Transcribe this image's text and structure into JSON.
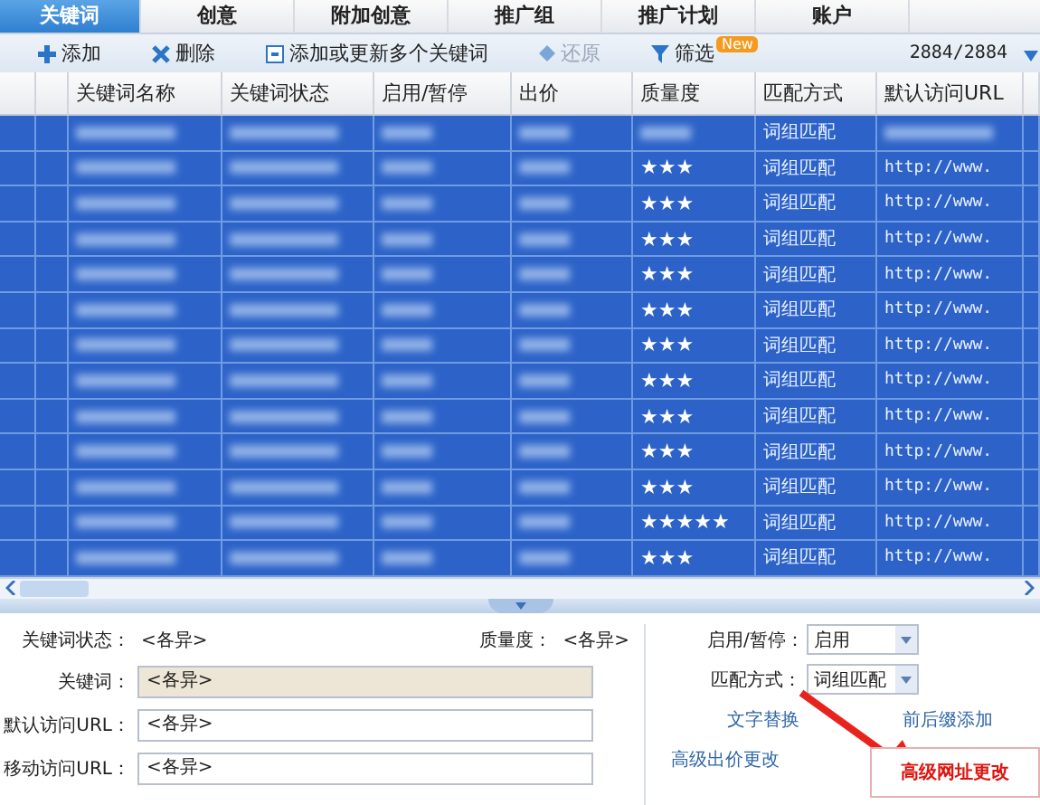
{
  "tabs": [
    {
      "label": "关键词",
      "selected": true
    },
    {
      "label": "创意",
      "selected": false
    },
    {
      "label": "附加创意",
      "selected": false
    },
    {
      "label": "推广组",
      "selected": false
    },
    {
      "label": "推广计划",
      "selected": false
    },
    {
      "label": "账户",
      "selected": false
    }
  ],
  "toolbar": {
    "buttons": [
      {
        "label": "添加",
        "kind": "plus",
        "disabled": false
      },
      {
        "label": "删除",
        "kind": "cross",
        "disabled": false
      },
      {
        "label": "添加或更新多个关键词",
        "kind": "box",
        "disabled": false
      },
      {
        "label": "还原",
        "kind": "diamond",
        "disabled": true
      },
      {
        "label": "筛选",
        "kind": "funnel",
        "disabled": false
      }
    ],
    "badge": "New",
    "count": "2884/2884"
  },
  "table": {
    "columns": [
      "关键词名称",
      "关键词状态",
      "启用/暂停",
      "出价",
      "质量度",
      "匹配方式",
      "默认访问URL"
    ],
    "rows": [
      {
        "selected": true,
        "match": "词组匹配"
      },
      {
        "selected": true,
        "stars": 3,
        "match": "词组匹配",
        "url": "http://www."
      },
      {
        "selected": true,
        "stars": 3,
        "match": "词组匹配",
        "url": "http://www."
      },
      {
        "selected": true,
        "stars": 3,
        "match": "词组匹配",
        "url": "http://www."
      },
      {
        "selected": true,
        "stars": 3,
        "match": "词组匹配",
        "url": "http://www."
      },
      {
        "selected": true,
        "stars": 3,
        "match": "词组匹配",
        "url": "http://www."
      },
      {
        "selected": true,
        "stars": 3,
        "match": "词组匹配",
        "url": "http://www."
      },
      {
        "selected": true,
        "stars": 3,
        "match": "词组匹配",
        "url": "http://www."
      },
      {
        "selected": true,
        "stars": 3,
        "match": "词组匹配",
        "url": "http://www."
      },
      {
        "selected": true,
        "stars": 3,
        "match": "词组匹配",
        "url": "http://www."
      },
      {
        "selected": true,
        "stars": 3,
        "match": "词组匹配",
        "url": "http://www."
      },
      {
        "selected": true,
        "stars": 5,
        "match": "词组匹配",
        "url": "http://www."
      },
      {
        "selected": true,
        "stars": 3,
        "match": "词组匹配",
        "url": "http://www."
      }
    ]
  },
  "form": {
    "info": [
      {
        "label": "关键词状态：",
        "value": "<各异>"
      },
      {
        "label": "质量度：",
        "value": "<各异>"
      }
    ],
    "fields": [
      {
        "label": "关键词：",
        "value": "<各异>",
        "kind": "highlight"
      },
      {
        "label": "默认访问URL：",
        "value": "<各异>",
        "kind": "plain"
      },
      {
        "label": "移动访问URL：",
        "value": "<各异>",
        "kind": "plain"
      }
    ],
    "selects": [
      {
        "label": "启用/暂停：",
        "value": "启用"
      },
      {
        "label": "匹配方式：",
        "value": "词组匹配"
      }
    ],
    "links": [
      "文字替换",
      "前后缀添加",
      "高级出价更改"
    ],
    "callout": "高级网址更改"
  }
}
